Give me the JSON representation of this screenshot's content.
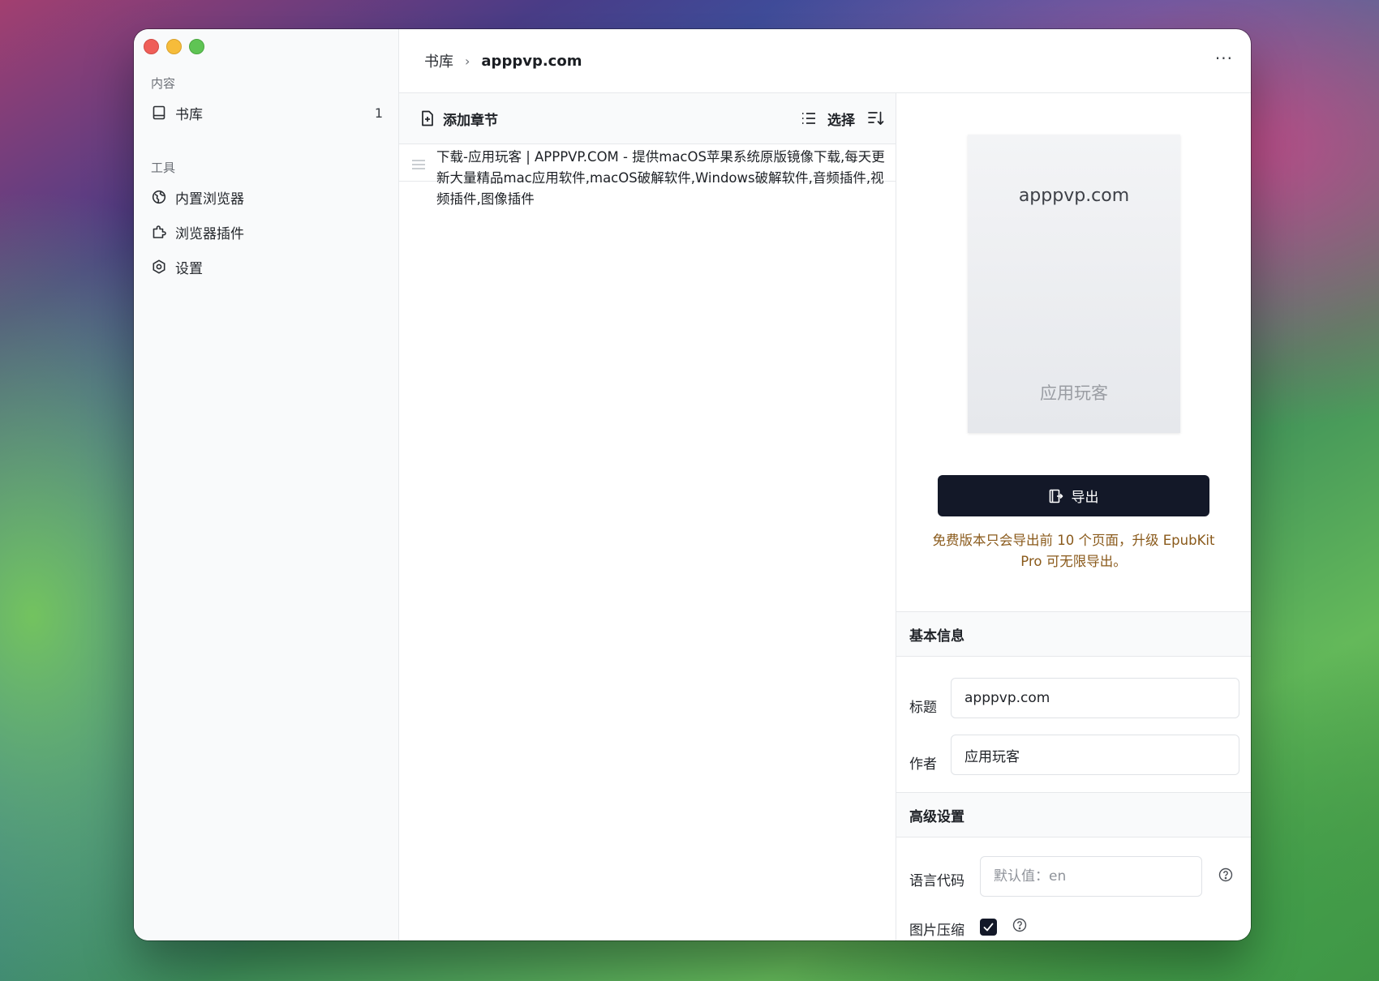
{
  "sidebar": {
    "content_label": "内容",
    "library": {
      "label": "书库",
      "count": "1",
      "icon": "book-icon"
    },
    "tools_label": "工具",
    "tools": [
      {
        "label": "内置浏览器",
        "icon": "globe-icon"
      },
      {
        "label": "浏览器插件",
        "icon": "puzzle-icon"
      },
      {
        "label": "设置",
        "icon": "settings-icon"
      }
    ]
  },
  "header": {
    "breadcrumb_root": "书库",
    "breadcrumb_sep": "›",
    "breadcrumb_current": "apppvp.com",
    "more": "···"
  },
  "chapters": {
    "add_label": "添加章节",
    "select_label": "选择",
    "items": [
      {
        "title": "下载-应用玩客 | APPPVP.COM - 提供macOS苹果系统原版镜像下载,每天更新大量精品mac应用软件,macOS破解软件,Windows破解软件,音频插件,视频插件,图像插件"
      }
    ]
  },
  "detail": {
    "cover_title": "apppvp.com",
    "cover_author": "应用玩客",
    "export_label": "导出",
    "notice": "免费版本只会导出前 10 个页面，升级 EpubKit Pro 可无限导出。",
    "basic": {
      "heading": "基本信息",
      "title_label": "标题",
      "title_value": "apppvp.com",
      "author_label": "作者",
      "author_value": "应用玩客"
    },
    "advanced": {
      "heading": "高级设置",
      "lang_label": "语言代码",
      "lang_placeholder": "默认值：en",
      "compress_label": "图片压缩",
      "compress_checked": true
    }
  },
  "colors": {
    "primary_button": "#131828",
    "notice_text": "#8a5a1b"
  }
}
